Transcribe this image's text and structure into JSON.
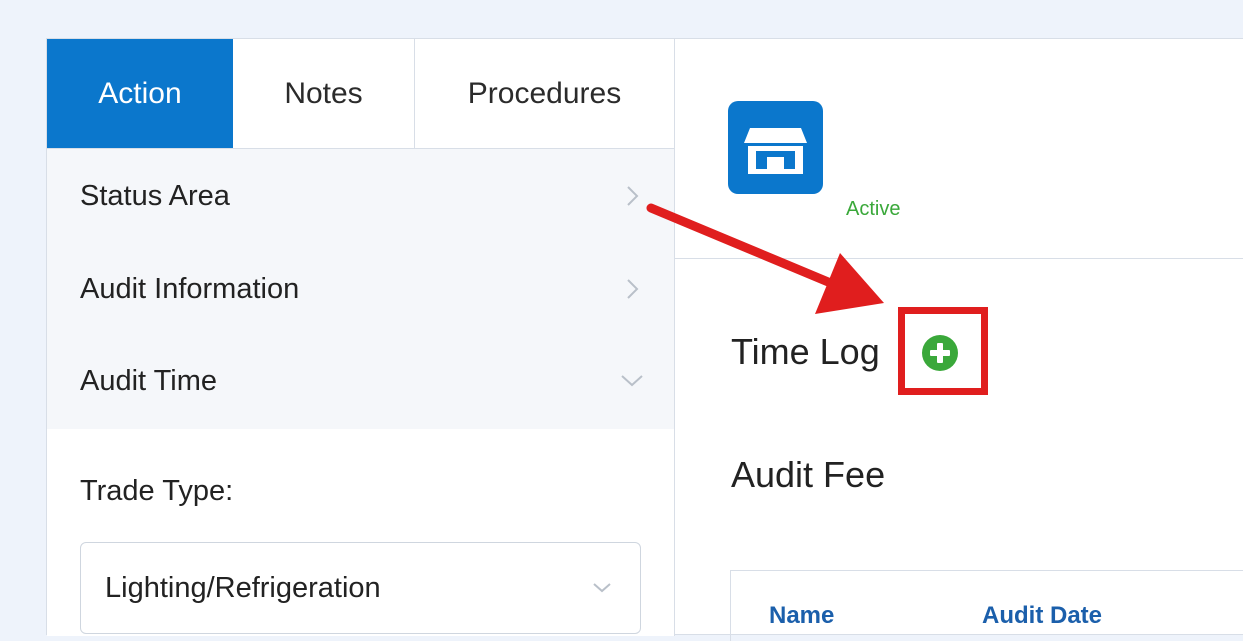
{
  "tabs": [
    {
      "label": "Action",
      "active": true
    },
    {
      "label": "Notes",
      "active": false
    },
    {
      "label": "Procedures",
      "active": false
    }
  ],
  "accordion": [
    {
      "label": "Status Area",
      "state": "collapsed",
      "icon": "chevron-right-icon"
    },
    {
      "label": "Audit Information",
      "state": "collapsed",
      "icon": "chevron-right-icon"
    },
    {
      "label": "Audit Time",
      "state": "expanded",
      "icon": "chevron-down-icon"
    }
  ],
  "trade_type": {
    "label": "Trade Type:",
    "value": "Lighting/Refrigeration"
  },
  "header": {
    "icon": "store-icon",
    "status": "Active"
  },
  "sections": {
    "time_log": "Time Log",
    "audit_fee": "Audit Fee"
  },
  "table": {
    "columns": [
      "Name",
      "Audit Date"
    ]
  },
  "colors": {
    "primary": "#0b77cc",
    "active_status": "#3aa83a",
    "add_button": "#3aa83a",
    "annotation": "#e01e1e",
    "column_header": "#1b5fab"
  }
}
